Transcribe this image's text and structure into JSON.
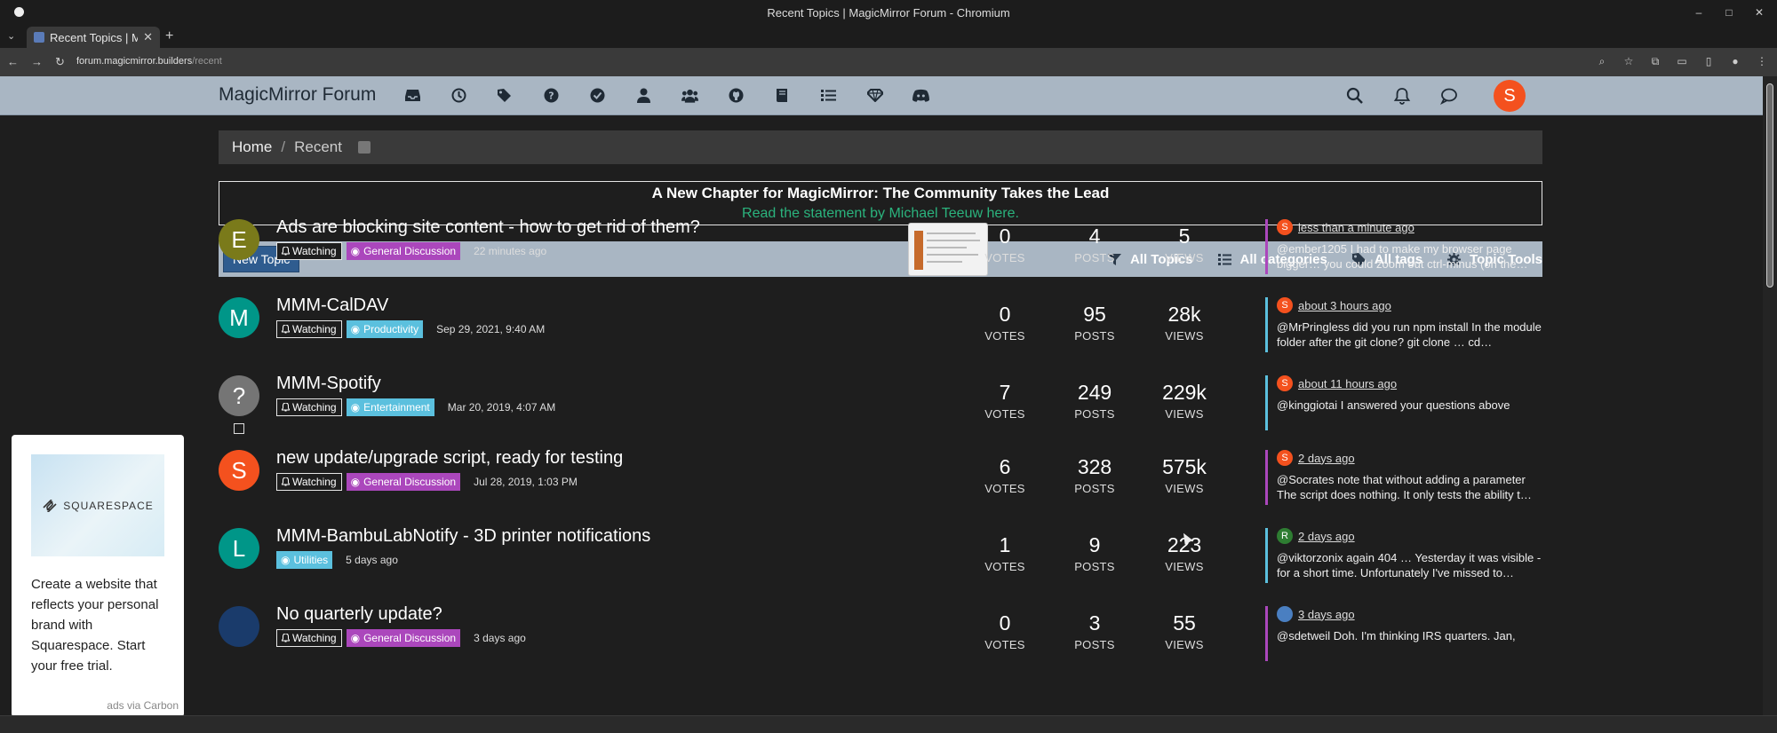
{
  "window": {
    "title": "Recent Topics | MagicMirror Forum - Chromium"
  },
  "browser": {
    "tab_title": "Recent Topics | Ma",
    "url_domain": "forum.magicmirror.builders",
    "url_path": "/recent"
  },
  "forum": {
    "brand": "MagicMirror Forum",
    "nav_icons": [
      "inbox-icon",
      "clock-icon",
      "tags-icon",
      "help-icon",
      "check-circle-icon",
      "user-icon",
      "users-icon",
      "github-icon",
      "book-icon",
      "list-icon",
      "diamond-icon",
      "discord-icon"
    ],
    "user_initial": "S",
    "user_color": "#f4511e"
  },
  "breadcrumb": {
    "home": "Home",
    "separator": "/",
    "current": "Recent"
  },
  "announcement": {
    "title": "A New Chapter for MagicMirror: The Community Takes the Lead",
    "link": "Read the statement by Michael Teeuw here."
  },
  "toolbar": {
    "new_topic": "New Topic",
    "all_topics": "All Topics",
    "all_categories": "All categories",
    "all_tags": "All tags",
    "topic_tools": "Topic Tools"
  },
  "labels": {
    "votes": "VOTES",
    "posts": "POSTS",
    "views": "VIEWS",
    "watching": "Watching"
  },
  "topics": [
    {
      "initial": "E",
      "avatar_color": "#7a7a1a",
      "title": "Ads are blocking site content - how to get rid of them?",
      "watching": true,
      "category": "General Discussion",
      "category_color": "#ab47bc",
      "date": "22 minutes ago",
      "votes": "0",
      "posts": "4",
      "views": "5",
      "last_initial": "S",
      "last_color": "#f4511e",
      "last_time": "less than a minute ago",
      "last_text": "@ember1205 I had to make my browser page bigger… you could zoom out ctrl-minus (on the…",
      "border_color": "#ab47bc",
      "has_thumb": true
    },
    {
      "initial": "M",
      "avatar_color": "#009688",
      "title": "MMM-CalDAV",
      "watching": true,
      "category": "Productivity",
      "category_color": "#5bc0de",
      "date": "Sep 29, 2021, 9:40 AM",
      "votes": "0",
      "posts": "95",
      "views": "28k",
      "last_initial": "S",
      "last_color": "#f4511e",
      "last_time": "about 3 hours ago",
      "last_text": "@MrPringless did you run npm install In the module folder after the git clone? git clone … cd…",
      "border_color": "#5bc0de"
    },
    {
      "initial": "?",
      "avatar_color": "#757575",
      "title": "MMM-Spotify",
      "watching": true,
      "category": "Entertainment",
      "category_color": "#5bc0de",
      "date": "Mar 20, 2019, 4:07 AM",
      "votes": "7",
      "posts": "249",
      "views": "229k",
      "last_initial": "S",
      "last_color": "#f4511e",
      "last_time": "about 11 hours ago",
      "last_text": "@kinggiotai I answered your questions above",
      "border_color": "#5bc0de"
    },
    {
      "initial": "S",
      "avatar_color": "#f4511e",
      "title": "new update/upgrade script, ready for testing",
      "watching": true,
      "category": "General Discussion",
      "category_color": "#ab47bc",
      "date": "Jul 28, 2019, 1:03 PM",
      "votes": "6",
      "posts": "328",
      "views": "575k",
      "last_initial": "S",
      "last_color": "#f4511e",
      "last_time": "2 days ago",
      "last_text": "@Socrates note that without adding a parameter The script does nothing. It only tests the ability t…",
      "border_color": "#ab47bc"
    },
    {
      "initial": "L",
      "avatar_color": "#009688",
      "title": "MMM-BambuLabNotify - 3D printer notifications",
      "watching": false,
      "category": "Utilities",
      "category_color": "#5bc0de",
      "date": "5 days ago",
      "votes": "1",
      "posts": "9",
      "views": "223",
      "last_initial": "R",
      "last_color": "#2e7d32",
      "last_time": "2 days ago",
      "last_text": "@viktorzonix again 404 … Yesterday it was visible - for a short time. Unfortunately I've missed to…",
      "border_color": "#5bc0de"
    },
    {
      "initial": "",
      "avatar_color": "#1a3b6b",
      "title": "No quarterly update?",
      "watching": true,
      "category": "General Discussion",
      "category_color": "#ab47bc",
      "date": "3 days ago",
      "votes": "0",
      "posts": "3",
      "views": "55",
      "last_initial": "",
      "last_color": "#4a7fc1",
      "last_time": "3 days ago",
      "last_text": "@sdetweil Doh. I'm thinking IRS quarters. Jan,",
      "border_color": "#ab47bc"
    }
  ],
  "ad": {
    "brand": "SQUARESPACE",
    "text": "Create a website that reflects your personal brand with Squarespace. Start your free trial.",
    "via": "ads via Carbon"
  }
}
